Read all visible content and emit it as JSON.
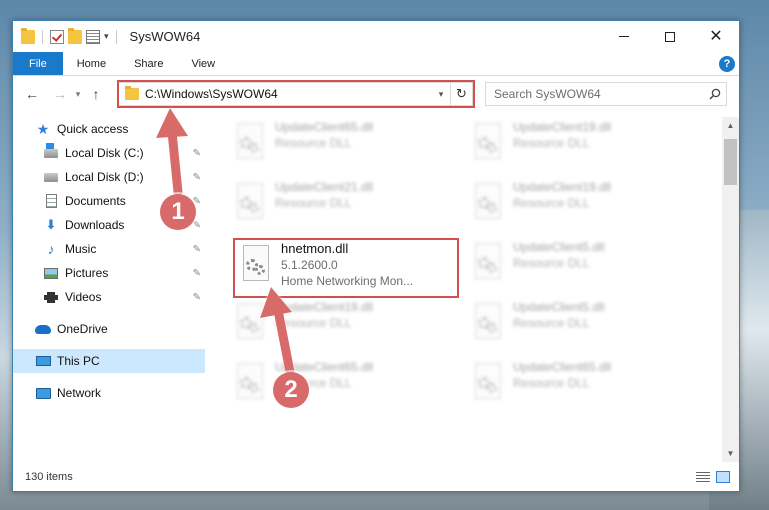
{
  "window": {
    "title": "SysWOW64"
  },
  "ribbon": {
    "tabs": [
      "File",
      "Home",
      "Share",
      "View"
    ],
    "help": "?"
  },
  "address": {
    "path": "C:\\Windows\\SysWOW64"
  },
  "search": {
    "placeholder": "Search SysWOW64"
  },
  "sidebar": {
    "items": [
      {
        "label": "Quick access",
        "icon": "star-icon"
      },
      {
        "label": "Local Disk (C:)",
        "icon": "drive-icon"
      },
      {
        "label": "Local Disk (D:)",
        "icon": "drive-icon"
      },
      {
        "label": "Documents",
        "icon": "documents-icon"
      },
      {
        "label": "Downloads",
        "icon": "downloads-icon"
      },
      {
        "label": "Music",
        "icon": "music-icon"
      },
      {
        "label": "Pictures",
        "icon": "pictures-icon"
      },
      {
        "label": "Videos",
        "icon": "videos-icon"
      },
      {
        "label": "OneDrive",
        "icon": "onedrive-icon"
      },
      {
        "label": "This PC",
        "icon": "this-pc-icon"
      },
      {
        "label": "Network",
        "icon": "network-icon"
      }
    ],
    "selected": "This PC"
  },
  "files": [
    {
      "name": "UpdateClient65.dll",
      "sub": "Resource DLL"
    },
    {
      "name": "UpdateClient19.dll",
      "sub": "Resource DLL"
    },
    {
      "name": "UpdateClient21.dll",
      "sub": "Resource DLL"
    },
    {
      "name": "UpdateClient19.dll",
      "sub": "Resource DLL"
    },
    {
      "name": "hnetmon.dll",
      "sub": "5.1.2600.0",
      "desc": "Home Networking Mon..."
    },
    {
      "name": "UpdateClient5.dll",
      "sub": "Resource DLL"
    },
    {
      "name": "UpdateClient19.dll",
      "sub": "Resource DLL"
    },
    {
      "name": "UpdateClient5.dll",
      "sub": "Resource DLL"
    },
    {
      "name": "UpdateClient65.dll",
      "sub": "Resource DLL"
    },
    {
      "name": "UpdateClient65.dll",
      "sub": "Resource DLL"
    }
  ],
  "status": {
    "item_count": "130 items"
  },
  "callouts": [
    "1",
    "2"
  ],
  "colors": {
    "accent": "#1979ca",
    "highlight": "#d34f4f",
    "callout": "#d96a6a",
    "selection": "#cce8ff"
  }
}
